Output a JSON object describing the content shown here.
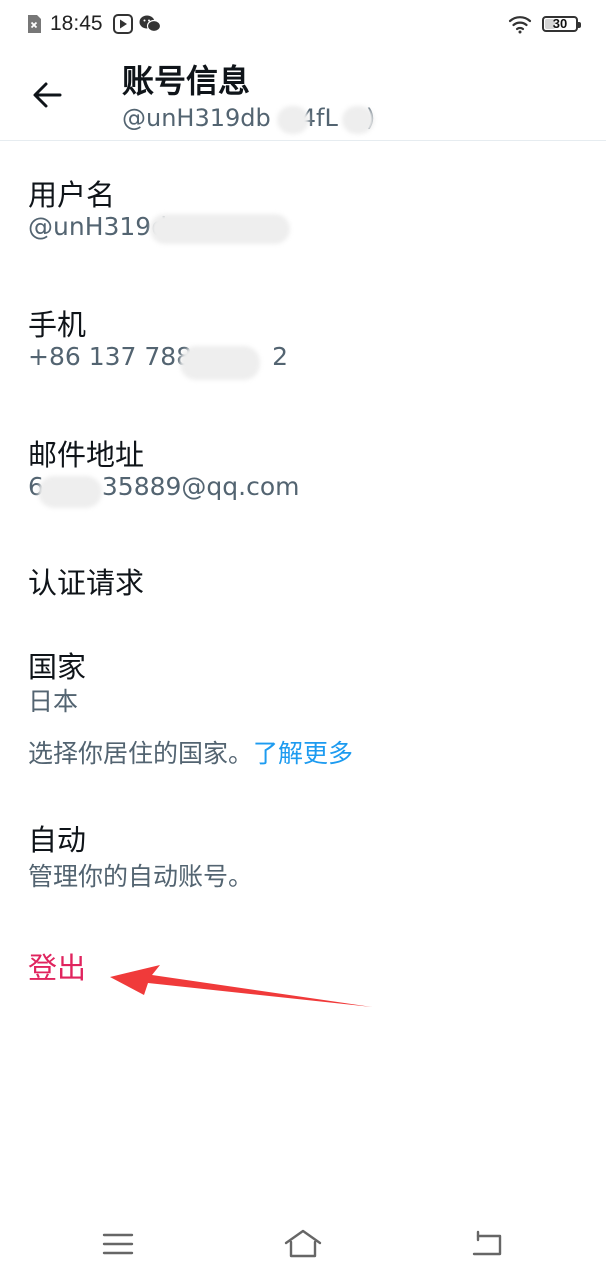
{
  "status_bar": {
    "time": "18:45",
    "battery": "30",
    "icons": [
      "sim-off-icon",
      "media-play-icon",
      "wechat-icon",
      "wifi-icon",
      "battery-icon"
    ]
  },
  "header": {
    "title": "账号信息",
    "subtitle": "@unH319db",
    "subtitle_tail": "4fL",
    "subtitle_end": ")"
  },
  "username": {
    "label": "用户名",
    "value": "@unH319d"
  },
  "phone": {
    "label": "手机",
    "value": "+86 137 788",
    "value_tail": "2"
  },
  "email": {
    "label": "邮件地址",
    "value_head": "6",
    "value": "35889@qq.com"
  },
  "verification": {
    "label": "认证请求"
  },
  "country": {
    "label": "国家",
    "value": "日本",
    "hint": "选择你居住的国家。",
    "link": "了解更多"
  },
  "automation": {
    "label": "自动",
    "value": "管理你的自动账号。"
  },
  "logout": {
    "label": "登出"
  },
  "annotation": {
    "color": "#f03a3a"
  },
  "navbar": {
    "icons": [
      "menu-icon",
      "home-icon",
      "back-icon"
    ]
  },
  "colors": {
    "primary_text": "#0f1419",
    "secondary_text": "#536471",
    "link": "#1d9bf0",
    "danger": "#e0245e"
  }
}
